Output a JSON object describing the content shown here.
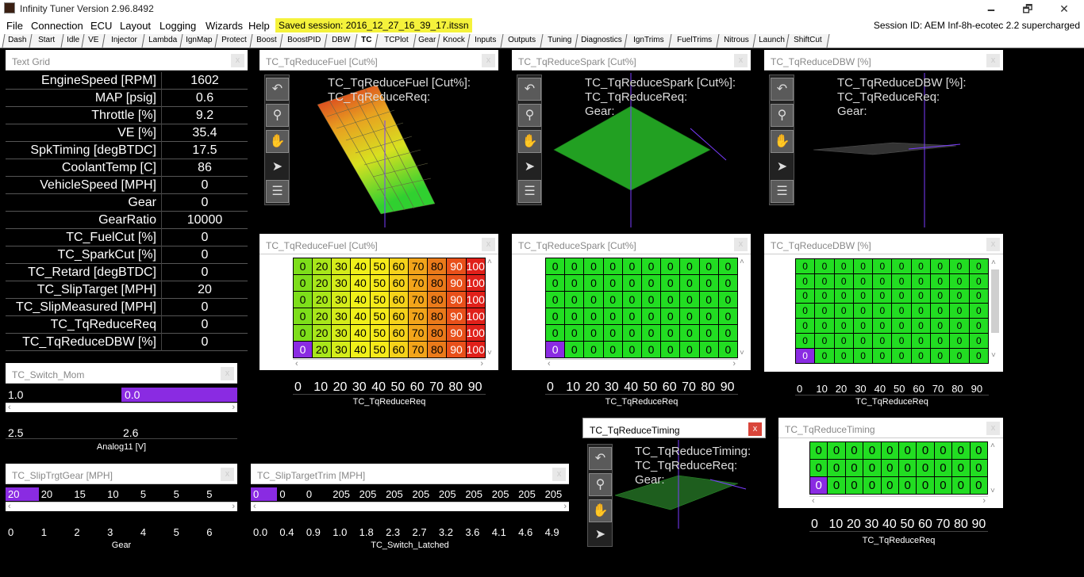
{
  "window": {
    "title": "Infinity Tuner Version 2.96.8492",
    "minimize": "🗕",
    "maximize": "🗗",
    "close": "✕"
  },
  "menu": {
    "items": [
      "File",
      "Connection",
      "ECU",
      "Layout",
      "Logging",
      "Wizards",
      "Help"
    ],
    "saved_session": "Saved session: 2016_12_27_16_39_17.itssn",
    "session_id": "Session ID: AEM Inf-8h-ecotec 2.2 supercharged"
  },
  "tabs": [
    "Dash",
    "Start",
    "Idle",
    "VE",
    "Injector",
    "Lambda",
    "IgnMap",
    "Protect",
    "Boost",
    "BoostPID",
    "DBW",
    "TC",
    "TCPlot",
    "Gear",
    "Knock",
    "Inputs",
    "Outputs",
    "Tuning",
    "Diagnostics",
    "IgnTrims",
    "FuelTrims",
    "Nitrous",
    "Launch",
    "ShiftCut"
  ],
  "active_tab": "TC",
  "text_grid": {
    "title": "Text Grid",
    "close": "x",
    "rows": [
      {
        "name": "EngineSpeed [RPM]",
        "value": "1602"
      },
      {
        "name": "MAP [psig]",
        "value": "0.6"
      },
      {
        "name": "Throttle [%]",
        "value": "9.2"
      },
      {
        "name": "VE [%]",
        "value": "35.4"
      },
      {
        "name": "SpkTiming [degBTDC]",
        "value": "17.5"
      },
      {
        "name": "CoolantTemp [C]",
        "value": "86"
      },
      {
        "name": "VehicleSpeed [MPH]",
        "value": "0"
      },
      {
        "name": "Gear",
        "value": "0"
      },
      {
        "name": "GearRatio",
        "value": "10000"
      },
      {
        "name": "TC_FuelCut [%]",
        "value": "0"
      },
      {
        "name": "TC_SparkCut [%]",
        "value": "0"
      },
      {
        "name": "TC_Retard [degBTDC]",
        "value": "0"
      },
      {
        "name": "TC_SlipTarget [MPH]",
        "value": "20"
      },
      {
        "name": "TC_SlipMeasured [MPH]",
        "value": "0"
      },
      {
        "name": "TC_TqReduceReq",
        "value": "0"
      },
      {
        "name": "TC_TqReduceDBW [%]",
        "value": "0"
      }
    ]
  },
  "switch_mom": {
    "title": "TC_Switch_Mom",
    "close": "x",
    "values": [
      "1.0",
      "0.0"
    ],
    "axis": [
      "2.5",
      "2.6"
    ],
    "xlabel": "Analog11 [V]",
    "scroll_left": "‹",
    "scroll_right": "›"
  },
  "slip_trgt_gear": {
    "title": "TC_SlipTrgtGear [MPH]",
    "close": "x",
    "values": [
      "20",
      "20",
      "15",
      "10",
      "5",
      "5",
      "5"
    ],
    "axis": [
      "0",
      "1",
      "2",
      "3",
      "4",
      "5",
      "6"
    ],
    "xlabel": "Gear",
    "scroll_left": "‹",
    "scroll_right": "›"
  },
  "slip_target_trim": {
    "title": "TC_SlipTargetTrim [MPH]",
    "close": "x",
    "values": [
      "0",
      "0",
      "0",
      "205",
      "205",
      "205",
      "205",
      "205",
      "205",
      "205",
      "205",
      "205"
    ],
    "axis": [
      "0.0",
      "0.4",
      "0.9",
      "1.0",
      "1.8",
      "2.3",
      "2.7",
      "3.2",
      "3.6",
      "4.1",
      "4.6",
      "4.9"
    ],
    "xlabel": "TC_Switch_Latched",
    "scroll_left": "‹",
    "scroll_right": "›"
  },
  "plots": [
    {
      "title": "TC_TqReduceFuel [Cut%]",
      "close": "x",
      "labels": [
        "TC_TqReduceFuel [Cut%]:",
        "TC_TqReduceReq:"
      ]
    },
    {
      "title": "TC_TqReduceSpark [Cut%]",
      "close": "x",
      "labels": [
        "TC_TqReduceSpark [Cut%]:",
        "TC_TqReduceReq:",
        "Gear:"
      ]
    },
    {
      "title": "TC_TqReduceDBW [%]",
      "close": "x",
      "labels": [
        "TC_TqReduceDBW [%]:",
        "TC_TqReduceReq:",
        "Gear:"
      ]
    },
    {
      "title": "TC_TqReduceTiming",
      "close": "x",
      "labels": [
        "TC_TqReduceTiming:",
        "TC_TqReduceReq:",
        "Gear:"
      ]
    }
  ],
  "toolbar_icons": [
    "undo-arrow-icon",
    "zoom-icon",
    "pan-hand-icon",
    "pointer-icon",
    "list-icon"
  ],
  "tables": {
    "fuel": {
      "title": "TC_TqReduceFuel [Cut%]",
      "close": "x",
      "ylabel": "Gear",
      "xlabel": "TC_TqReduceReq",
      "rows": [
        "6",
        "5",
        "4",
        "3",
        "2",
        "1"
      ],
      "cols": [
        "0",
        "10",
        "20",
        "30",
        "40",
        "50",
        "60",
        "70",
        "80",
        "90"
      ],
      "row_values": [
        "0",
        "20",
        "30",
        "40",
        "50",
        "60",
        "70",
        "80",
        "90",
        "100"
      ],
      "scroll_up": "˄",
      "scroll_down": "˅",
      "scroll_left": "‹",
      "scroll_right": "›"
    },
    "spark": {
      "title": "TC_TqReduceSpark [Cut%]",
      "close": "x",
      "ylabel": "Gear",
      "xlabel": "TC_TqReduceReq",
      "rows": [
        "6",
        "5",
        "4",
        "3",
        "2",
        "1"
      ],
      "cols": [
        "0",
        "10",
        "20",
        "30",
        "40",
        "50",
        "60",
        "70",
        "80",
        "90"
      ],
      "cell": "0",
      "scroll_up": "˄",
      "scroll_down": "˅",
      "scroll_left": "‹",
      "scroll_right": "›"
    },
    "dbw": {
      "title": "TC_TqReduceDBW [%]",
      "close": "x",
      "ylabel": "Gear",
      "xlabel": "TC_TqReduceReq",
      "rows": [
        "6",
        "5",
        "4",
        "3",
        "2",
        "1",
        "0"
      ],
      "cols": [
        "0",
        "10",
        "20",
        "30",
        "40",
        "50",
        "60",
        "70",
        "80",
        "90"
      ],
      "cell": "0",
      "scroll_up": "˄",
      "scroll_down": "˅"
    },
    "timing": {
      "title": "TC_TqReduceTiming",
      "close": "x",
      "ylabel": "Gear",
      "xlabel": "TC_TqReduceReq",
      "rows": [
        "3",
        "2",
        "1"
      ],
      "cols": [
        "0",
        "10",
        "20",
        "30",
        "40",
        "50",
        "60",
        "70",
        "80",
        "90"
      ],
      "cell": "0",
      "scroll_up": "˄",
      "scroll_down": "˅",
      "scroll_left": "‹",
      "scroll_right": "›"
    }
  },
  "colors": {
    "green": "#22dd22",
    "purple": "#8a2be2",
    "table_border": "#000",
    "fuel_cells": [
      "#7dde1a",
      "#a8e61a",
      "#d4ec1a",
      "#f0f01a",
      "#f6ea1a",
      "#f5d21a",
      "#f2a41a",
      "#ea7a1a",
      "#e8501a",
      "#e0201a"
    ]
  }
}
